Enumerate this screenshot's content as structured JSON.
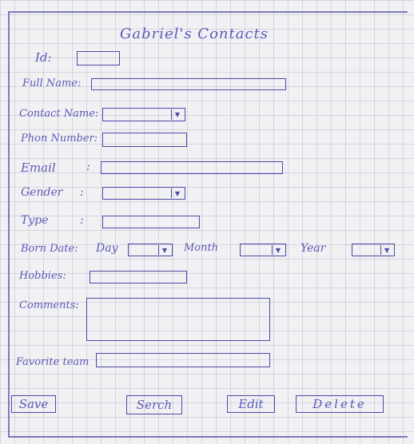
{
  "title": "Gabriel's Contacts",
  "fields": {
    "id": "Id:",
    "full_name": "Full Name:",
    "contact_name": "Contact Name:",
    "phone_number": "Phon Number:",
    "email": "Email",
    "gender": "Gender",
    "type": "Type",
    "born_date": "Born Date:",
    "day": "Day",
    "month": "Month",
    "year": "Year",
    "hobbies": "Hobbies:",
    "comments": "Comments:",
    "favorite_team": "Favorite team"
  },
  "colon": ":",
  "dropdown_glyph": "▼",
  "buttons": {
    "save": "Save",
    "search": "Serch",
    "edit": "Edit",
    "delete": "Delete"
  },
  "colors": {
    "ink": "#5a5ab8",
    "paper": "#f1f1f4",
    "grid": "#b4b4c8"
  }
}
